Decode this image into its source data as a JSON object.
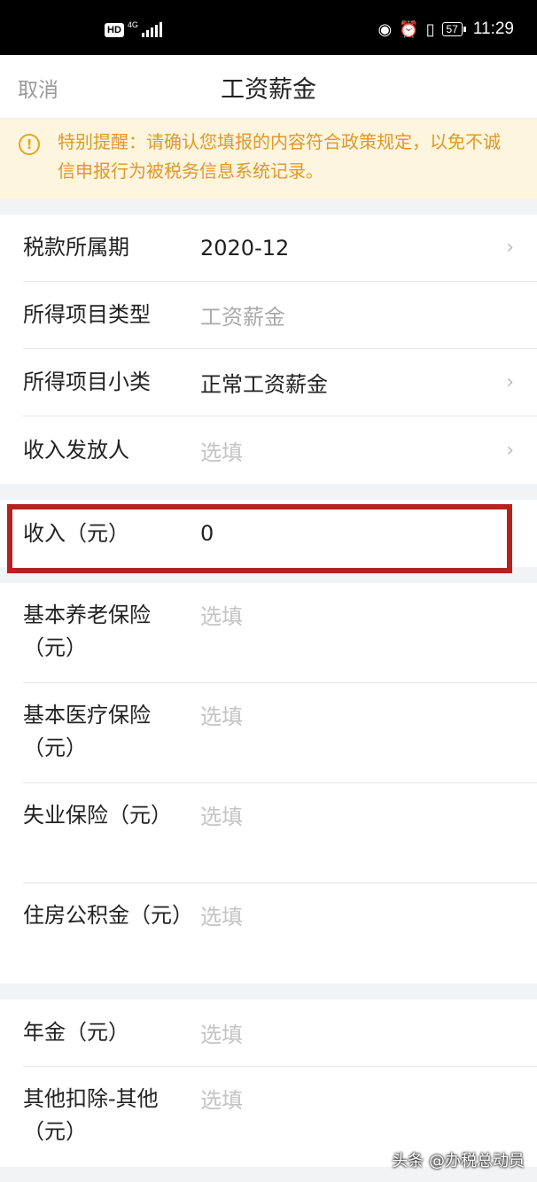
{
  "status_bar": {
    "hd": "HD",
    "network": "4G",
    "battery": "57",
    "time": "11:29"
  },
  "nav": {
    "cancel": "取消",
    "title": "工资薪金"
  },
  "notice": {
    "icon": "!",
    "text": "特别提醒：请确认您填报的内容符合政策规定，以免不诚信申报行为被税务信息系统记录。"
  },
  "group1": [
    {
      "label": "税款所属期",
      "value": "2020-12"
    },
    {
      "label": "所得项目类型",
      "value": "工资薪金"
    },
    {
      "label": "所得项目小类",
      "value": "正常工资薪金"
    },
    {
      "label": "收入发放人",
      "value": "选填"
    }
  ],
  "income": {
    "label": "收入（元）",
    "value": "0"
  },
  "group3": [
    {
      "label": "基本养老保险（元）",
      "value": "选填"
    },
    {
      "label": "基本医疗保险（元）",
      "value": "选填"
    },
    {
      "label": "失业保险（元）",
      "value": "选填"
    },
    {
      "label": "住房公积金（元）",
      "value": "选填"
    }
  ],
  "group4": [
    {
      "label": "年金（元）",
      "value": "选填"
    },
    {
      "label": "其他扣除-其他（元）",
      "value": "选填"
    }
  ],
  "watermark": "头条 @办税总动员",
  "colors": {
    "notice_bg": "#fdf5de",
    "notice_text": "#e0982a",
    "highlight_border": "#b5221f"
  }
}
